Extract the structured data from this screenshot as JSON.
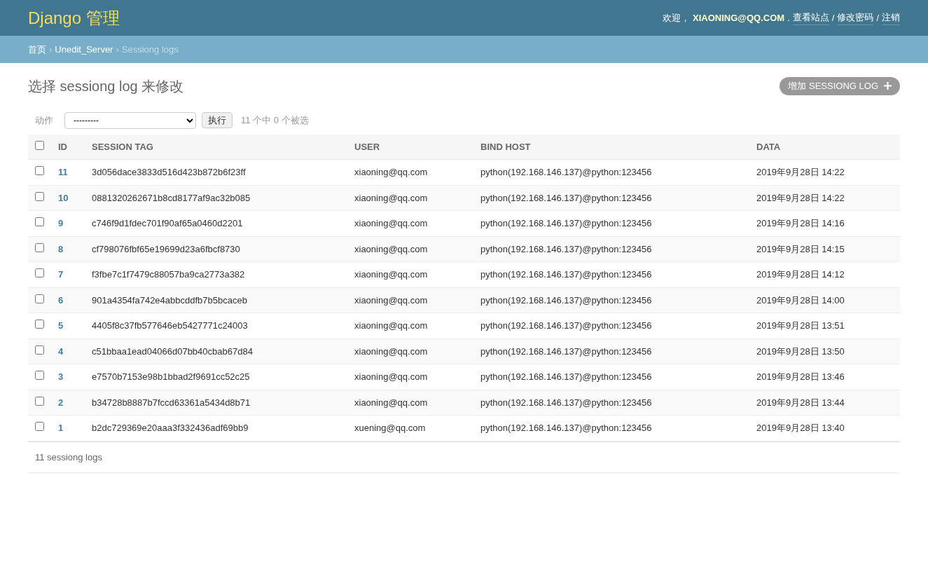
{
  "header": {
    "brand": "Django 管理",
    "user_tools": [
      {
        "kind": "text",
        "text": "欢迎，"
      },
      {
        "kind": "user",
        "text": "XIAONING@QQ.COM"
      },
      {
        "kind": "text",
        "text": "."
      },
      {
        "kind": "link",
        "text": "查看站点"
      },
      {
        "kind": "text",
        "text": "/"
      },
      {
        "kind": "link",
        "text": "修改密码"
      },
      {
        "kind": "text",
        "text": "/"
      },
      {
        "kind": "link",
        "text": "注销"
      }
    ]
  },
  "breadcrumbs": [
    {
      "kind": "link",
      "text": "首页"
    },
    {
      "kind": "separator",
      "text": "›"
    },
    {
      "kind": "link",
      "text": "Unedit_Server"
    },
    {
      "kind": "separator",
      "text": "›"
    },
    {
      "kind": "current",
      "text": "Sessiong logs"
    }
  ],
  "title": "选择 sessiong log 来修改",
  "add_button": {
    "label": "增加 SESSIONG LOG"
  },
  "actions": {
    "label": "动作",
    "select_value": "---------",
    "go_button": "执行",
    "counter": "11 个中 0 个被选"
  },
  "table": {
    "select_all_checked": false,
    "columns": [
      "ID",
      "SESSION TAG",
      "USER",
      "BIND HOST",
      "DATA"
    ],
    "rows": [
      {
        "checked": false,
        "cells": [
          "11",
          "3d056dace3833d516d423b872b6f23ff",
          "xiaoning@qq.com",
          "python(192.168.146.137)@python:123456",
          "2019年9月28日 14:22"
        ]
      },
      {
        "checked": false,
        "cells": [
          "10",
          "0881320262671b8cd8177af9ac32b085",
          "xiaoning@qq.com",
          "python(192.168.146.137)@python:123456",
          "2019年9月28日 14:22"
        ]
      },
      {
        "checked": false,
        "cells": [
          "9",
          "c746f9d1fdec701f90af65a0460d2201",
          "xiaoning@qq.com",
          "python(192.168.146.137)@python:123456",
          "2019年9月28日 14:16"
        ]
      },
      {
        "checked": false,
        "cells": [
          "8",
          "cf798076fbf65e19699d23a6fbcf8730",
          "xiaoning@qq.com",
          "python(192.168.146.137)@python:123456",
          "2019年9月28日 14:15"
        ]
      },
      {
        "checked": false,
        "cells": [
          "7",
          "f3fbe7c1f7479c88057ba9ca2773a382",
          "xiaoning@qq.com",
          "python(192.168.146.137)@python:123456",
          "2019年9月28日 14:12"
        ]
      },
      {
        "checked": false,
        "cells": [
          "6",
          "901a4354fa742e4abbcddfb7b5bcaceb",
          "xiaoning@qq.com",
          "python(192.168.146.137)@python:123456",
          "2019年9月28日 14:00"
        ]
      },
      {
        "checked": false,
        "cells": [
          "5",
          "4405f8c37fb577646eb5427771c24003",
          "xiaoning@qq.com",
          "python(192.168.146.137)@python:123456",
          "2019年9月28日 13:51"
        ]
      },
      {
        "checked": false,
        "cells": [
          "4",
          "c51bbaa1ead04066d07bb40cbab67d84",
          "xiaoning@qq.com",
          "python(192.168.146.137)@python:123456",
          "2019年9月28日 13:50"
        ]
      },
      {
        "checked": false,
        "cells": [
          "3",
          "e7570b7153e98b1bbad2f9691cc52c25",
          "xiaoning@qq.com",
          "python(192.168.146.137)@python:123456",
          "2019年9月28日 13:46"
        ]
      },
      {
        "checked": false,
        "cells": [
          "2",
          "b34728b8887b7fccd63361a5434d8b71",
          "xiaoning@qq.com",
          "python(192.168.146.137)@python:123456",
          "2019年9月28日 13:44"
        ]
      },
      {
        "checked": false,
        "cells": [
          "1",
          "b2dc729369e20aaa3f332436adf69bb9",
          "xuening@qq.com",
          "python(192.168.146.137)@python:123456",
          "2019年9月28日 13:40"
        ]
      }
    ]
  },
  "paginator": "11 sessiong logs"
}
